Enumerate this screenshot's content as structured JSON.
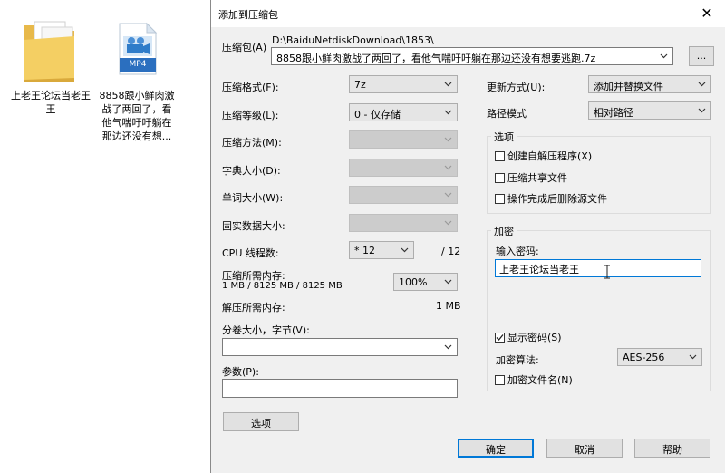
{
  "desktop": {
    "folder_label": "上老王论坛当老王",
    "file_label_lines": [
      "8858跟小鲜肉激",
      "战了两回了，看",
      "他气喘吁吁躺在",
      "那边还没有想..."
    ],
    "file_badge": "MP4"
  },
  "dialog": {
    "title": "添加到压缩包",
    "close_glyph": "✕",
    "archive_label": "压缩包(A)",
    "archive_path": "D:\\BaiduNetdiskDownload\\1853\\",
    "archive_name": "8858跟小鲜肉激战了两回了，看他气喘吁吁躺在那边还没有想要逃跑.7z",
    "browse_label": "...",
    "left": {
      "format_label": "压缩格式(F):",
      "format_value": "7z",
      "level_label": "压缩等级(L):",
      "level_value": "0 - 仅存储",
      "method_label": "压缩方法(M):",
      "dict_label": "字典大小(D):",
      "word_label": "单词大小(W):",
      "solid_label": "固实数据大小:",
      "cpu_label": "CPU 线程数:",
      "cpu_value": "* 12",
      "cpu_total": "/ 12",
      "mem_comp_label": "压缩所需内存:",
      "mem_comp_value": "1 MB / 8125 MB / 8125 MB",
      "mem_percent": "100%",
      "mem_decomp_label": "解压所需内存:",
      "mem_decomp_value": "1 MB",
      "split_label": "分卷大小，字节(V):",
      "params_label": "参数(P):",
      "options_button": "选项"
    },
    "right": {
      "update_label": "更新方式(U):",
      "update_value": "添加并替换文件",
      "path_label": "路径模式",
      "path_value": "相对路径",
      "options_group": "选项",
      "opt_sfx": "创建自解压程序(X)",
      "opt_shared": "压缩共享文件",
      "opt_delete": "操作完成后删除源文件",
      "enc_group": "加密",
      "password_label": "输入密码:",
      "password_value": "上老王论坛当老王",
      "show_password": "显示密码(S)",
      "enc_method_label": "加密算法:",
      "enc_method_value": "AES-256",
      "enc_names": "加密文件名(N)"
    },
    "buttons": {
      "ok": "确定",
      "cancel": "取消",
      "help": "帮助"
    }
  }
}
